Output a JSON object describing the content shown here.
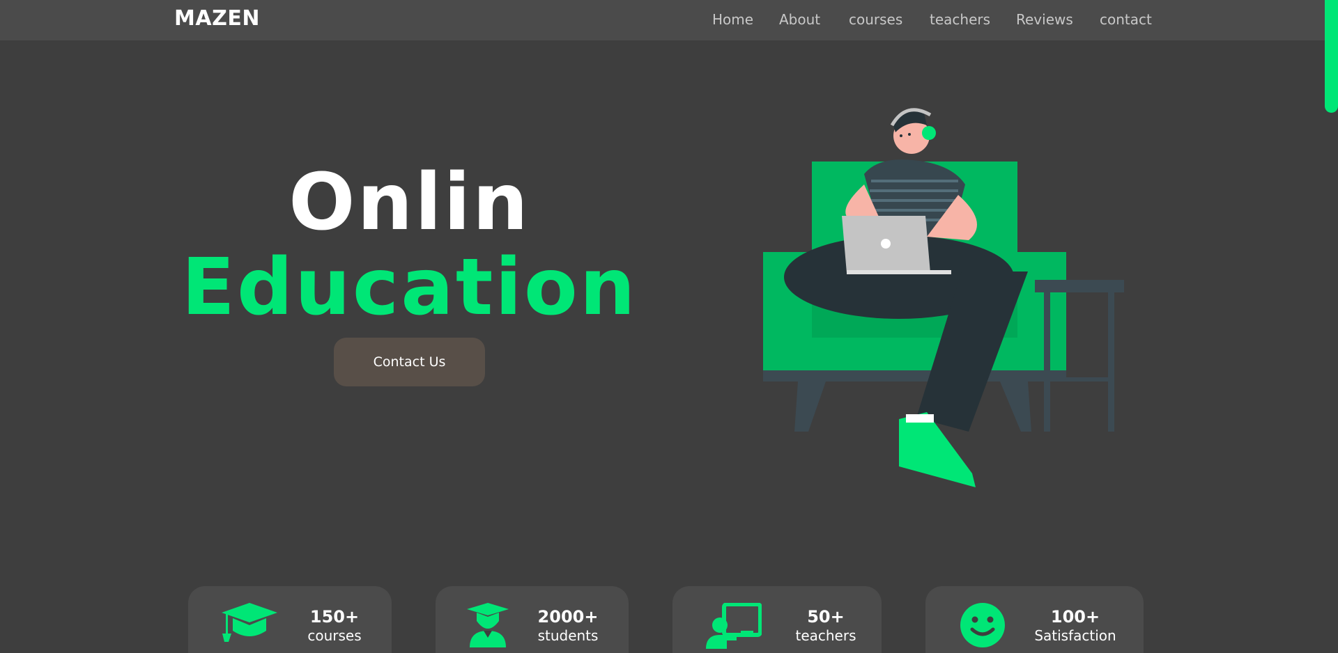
{
  "brand": {
    "logo": "MAZEN",
    "accent": "#00e676",
    "header_bg": "#4b4b4b",
    "page_bg": "#3e3e3e"
  },
  "nav": [
    {
      "label": "Home"
    },
    {
      "label": "About"
    },
    {
      "label": "courses"
    },
    {
      "label": "teachers"
    },
    {
      "label": "Reviews"
    },
    {
      "label": "contact"
    }
  ],
  "hero": {
    "title_line1": "Onlin",
    "title_line2": "Education",
    "button_label": "Contact Us"
  },
  "stats": [
    {
      "icon": "graduation-cap-icon",
      "number": "150+",
      "label": "courses"
    },
    {
      "icon": "student-icon",
      "number": "2000+",
      "label": "students"
    },
    {
      "icon": "teacher-board-icon",
      "number": "50+",
      "label": "teachers"
    },
    {
      "icon": "smile-icon",
      "number": "100+",
      "label": "Satisfaction"
    }
  ]
}
